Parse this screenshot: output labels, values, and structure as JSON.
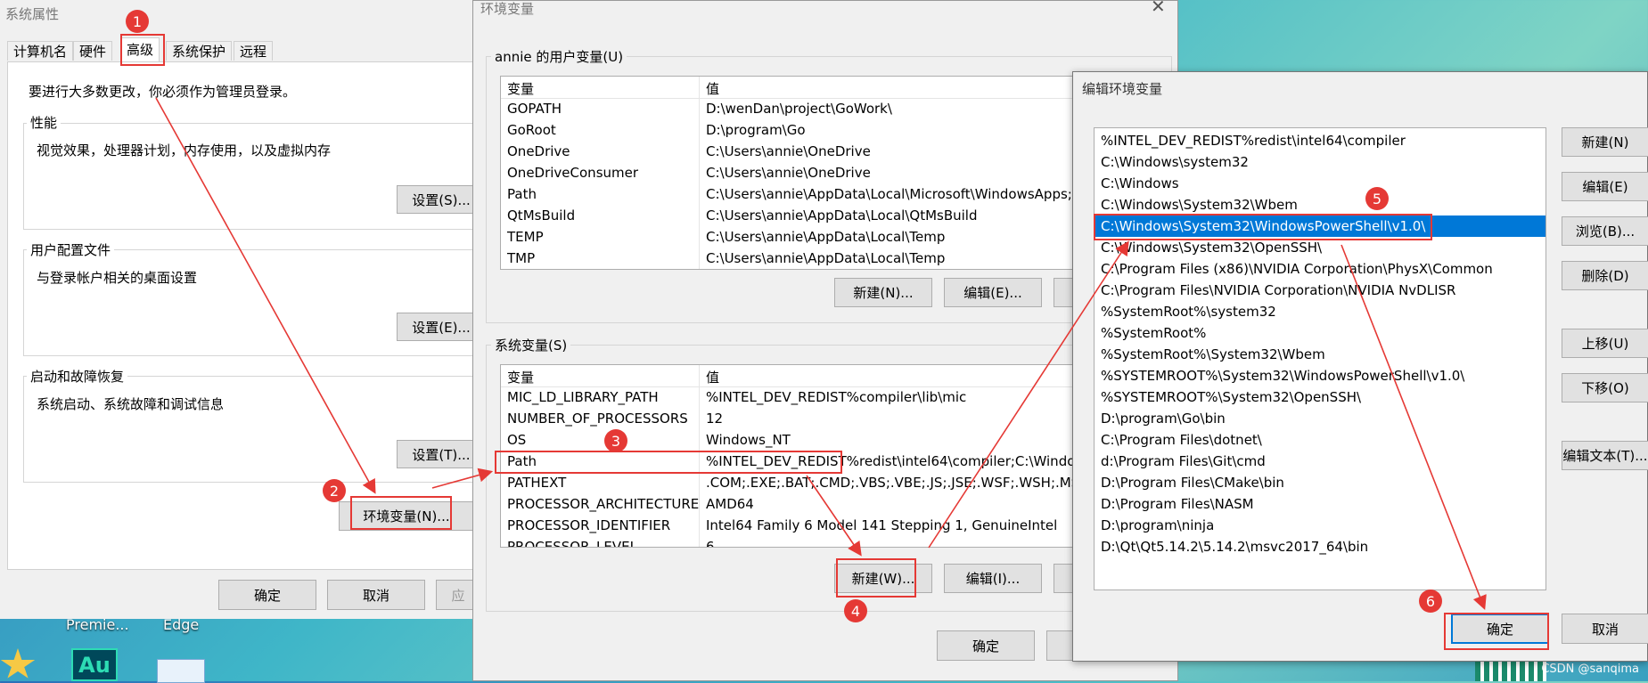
{
  "sysprops": {
    "title": "系统属性",
    "tabs": [
      "计算机名",
      "硬件",
      "高级",
      "系统保护",
      "远程"
    ],
    "admin_note": "要进行大多数更改，你必须作为管理员登录。",
    "performance": {
      "label": "性能",
      "desc": "视觉效果，处理器计划，内存使用，以及虚拟内存",
      "button": "设置(S)..."
    },
    "profile": {
      "label": "用户配置文件",
      "desc": "与登录帐户相关的桌面设置",
      "button": "设置(E)..."
    },
    "startup": {
      "label": "启动和故障恢复",
      "desc": "系统启动、系统故障和调试信息",
      "button": "设置(T)..."
    },
    "env_button": "环境变量(N)...",
    "ok": "确定",
    "cancel": "取消",
    "apply": "应"
  },
  "envvars": {
    "title": "环境变量",
    "user_label": "annie 的用户变量(U)",
    "col_var": "变量",
    "col_val": "值",
    "user_rows": [
      {
        "name": "GOPATH",
        "value": "D:\\wenDan\\project\\GoWork\\"
      },
      {
        "name": "GoRoot",
        "value": "D:\\program\\Go"
      },
      {
        "name": "OneDrive",
        "value": "C:\\Users\\annie\\OneDrive"
      },
      {
        "name": "OneDriveConsumer",
        "value": "C:\\Users\\annie\\OneDrive"
      },
      {
        "name": "Path",
        "value": "C:\\Users\\annie\\AppData\\Local\\Microsoft\\WindowsApps;E"
      },
      {
        "name": "QtMsBuild",
        "value": "C:\\Users\\annie\\AppData\\Local\\QtMsBuild"
      },
      {
        "name": "TEMP",
        "value": "C:\\Users\\annie\\AppData\\Local\\Temp"
      },
      {
        "name": "TMP",
        "value": "C:\\Users\\annie\\AppData\\Local\\Temp"
      }
    ],
    "user_new": "新建(N)...",
    "user_edit": "编辑(E)...",
    "sys_label": "系统变量(S)",
    "sys_rows": [
      {
        "name": "MIC_LD_LIBRARY_PATH",
        "value": "%INTEL_DEV_REDIST%compiler\\lib\\mic"
      },
      {
        "name": "NUMBER_OF_PROCESSORS",
        "value": "12"
      },
      {
        "name": "OS",
        "value": "Windows_NT"
      },
      {
        "name": "Path",
        "value": "%INTEL_DEV_REDIST%redist\\intel64\\compiler;C:\\Windows"
      },
      {
        "name": "PATHEXT",
        "value": ".COM;.EXE;.BAT;.CMD;.VBS;.VBE;.JS;.JSE;.WSF;.WSH;.MSC"
      },
      {
        "name": "PROCESSOR_ARCHITECTURE",
        "value": "AMD64"
      },
      {
        "name": "PROCESSOR_IDENTIFIER",
        "value": "Intel64 Family 6 Model 141 Stepping 1, GenuineIntel"
      },
      {
        "name": "PROCESSOR_LEVEL",
        "value": "6"
      }
    ],
    "sys_new": "新建(W)...",
    "sys_edit": "编辑(I)...",
    "ok": "确定"
  },
  "editenv": {
    "title": "编辑环境变量",
    "entries": [
      "%INTEL_DEV_REDIST%redist\\intel64\\compiler",
      "C:\\Windows\\system32",
      "C:\\Windows",
      "C:\\Windows\\System32\\Wbem",
      "C:\\Windows\\System32\\WindowsPowerShell\\v1.0\\",
      "C:\\Windows\\System32\\OpenSSH\\",
      "C:\\Program Files (x86)\\NVIDIA Corporation\\PhysX\\Common",
      "C:\\Program Files\\NVIDIA Corporation\\NVIDIA NvDLISR",
      "%SystemRoot%\\system32",
      "%SystemRoot%",
      "%SystemRoot%\\System32\\Wbem",
      "%SYSTEMROOT%\\System32\\WindowsPowerShell\\v1.0\\",
      "%SYSTEMROOT%\\System32\\OpenSSH\\",
      "D:\\program\\Go\\bin",
      "C:\\Program Files\\dotnet\\",
      "d:\\Program Files\\Git\\cmd",
      "D:\\Program Files\\CMake\\bin",
      "D:\\Program Files\\NASM",
      "D:\\program\\ninja",
      "D:\\Qt\\Qt5.14.2\\5.14.2\\msvc2017_64\\bin"
    ],
    "selected_index": 4,
    "buttons": {
      "new": "新建(N)",
      "edit": "编辑(E)",
      "browse": "浏览(B)...",
      "delete": "删除(D)",
      "up": "上移(U)",
      "down": "下移(O)",
      "edit_text": "编辑文本(T)..."
    },
    "ok": "确定",
    "cancel": "取消"
  },
  "desktop": {
    "items": [
      "Premie...",
      "Edge",
      "Au"
    ],
    "watermark": "CSDN @sanqima"
  },
  "badges": [
    "1",
    "2",
    "3",
    "4",
    "5",
    "6"
  ],
  "colors": {
    "annotation": "#e53935",
    "selection": "#0078d7"
  }
}
